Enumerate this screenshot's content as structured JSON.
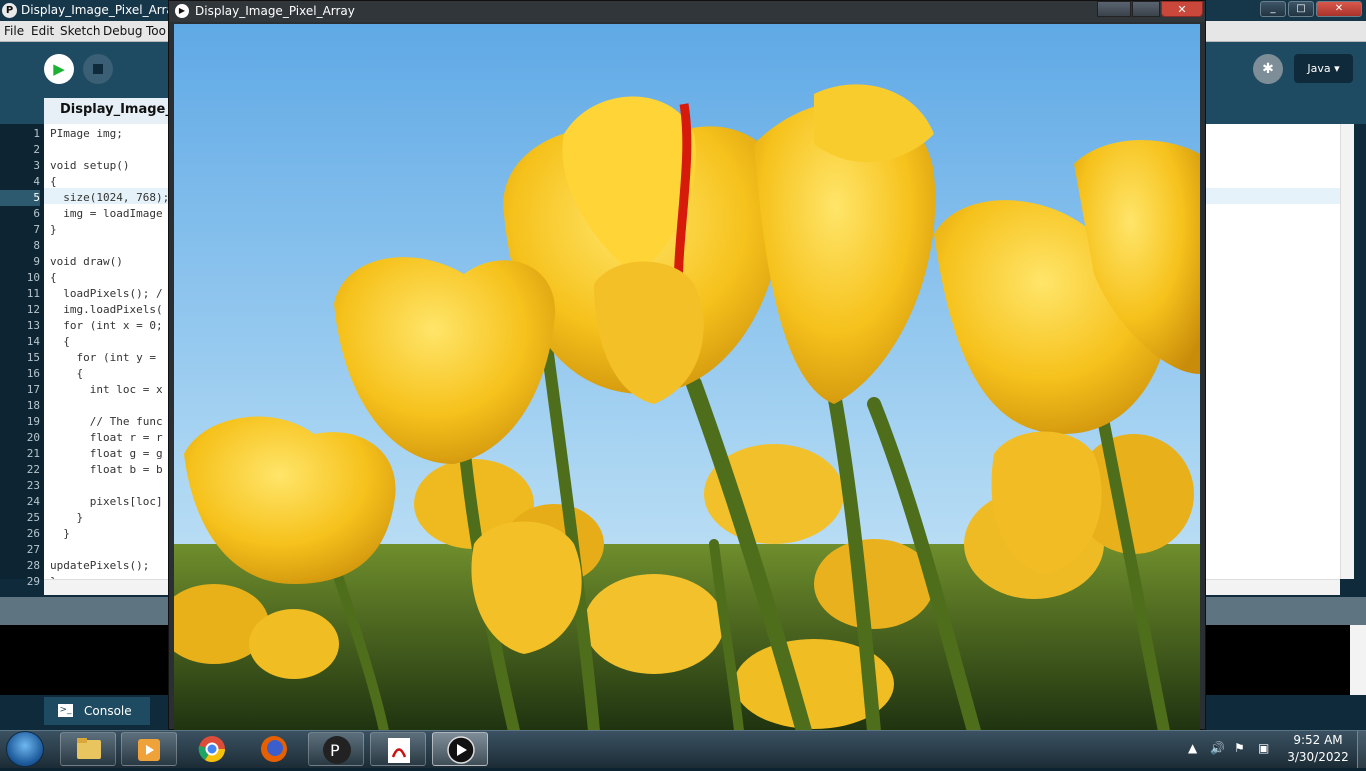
{
  "ide": {
    "window_title": "Display_Image_Pixel_Array",
    "menu": [
      "File",
      "Edit",
      "Sketch",
      "Debug",
      "Too"
    ],
    "sketch_tab": "Display_Image_Pi",
    "mode": "Java ▾",
    "active_line": 5,
    "line_numbers": [
      "1",
      "2",
      "3",
      "4",
      "5",
      "6",
      "7",
      "8",
      "9",
      "10",
      "11",
      "12",
      "13",
      "14",
      "15",
      "16",
      "17",
      "18",
      "19",
      "20",
      "21",
      "22",
      "23",
      "24",
      "25",
      "26",
      "27",
      "28",
      "29"
    ],
    "code": [
      "PImage img;",
      "",
      "void setup()",
      "{",
      "  size(1024, 768);",
      "  img = loadImage",
      "}",
      "",
      "void draw()",
      "{",
      "  loadPixels(); /",
      "  img.loadPixels(",
      "  for (int x = 0;",
      "  {",
      "    for (int y = ",
      "    {",
      "      int loc = x",
      "",
      "      // The func",
      "      float r = r",
      "      float g = g",
      "      float b = b",
      "",
      "      pixels[loc]",
      "    }",
      "  }",
      "",
      "updatePixels();",
      "}"
    ],
    "console_tab": "Console"
  },
  "sketch_window": {
    "title": "Display_Image_Pixel_Array"
  },
  "taskbar": {
    "apps": [
      {
        "name": "windows-explorer",
        "active": false
      },
      {
        "name": "media-player",
        "active": false
      },
      {
        "name": "chrome",
        "active": false
      },
      {
        "name": "firefox",
        "active": false
      },
      {
        "name": "processing",
        "active": false
      },
      {
        "name": "pdf-reader",
        "active": false
      },
      {
        "name": "processing-sketch",
        "active": true
      }
    ],
    "time": "9:52 AM",
    "date": "3/30/2022"
  },
  "colors": {
    "ide_bg": "#0f2a3b",
    "toolbar": "#1f4b62",
    "run_green": "#1db236",
    "sky": "#8fc6ee",
    "tulip_yellow": "#f6c21c",
    "stem_green": "#4f6e1b"
  }
}
